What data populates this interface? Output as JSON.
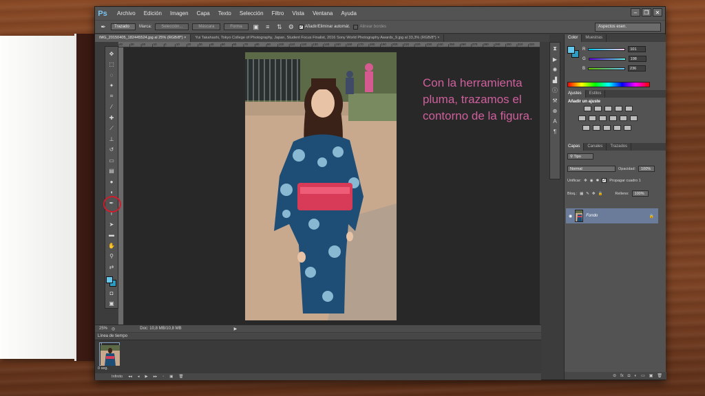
{
  "app": {
    "logo": "Ps",
    "menu": [
      "Archivo",
      "Edición",
      "Imagen",
      "Capa",
      "Texto",
      "Selección",
      "Filtro",
      "Vista",
      "Ventana",
      "Ayuda"
    ],
    "window_controls": [
      "minimize-icon",
      "restore-icon",
      "close-icon"
    ]
  },
  "options": {
    "tool_mode": "Trazado",
    "marca_label": "Marca:",
    "seleccion": "Selección...",
    "mascara": "Máscara",
    "forma": "Forma",
    "auto_add": "Añadir/Eliminar automát.",
    "align_edges": "Alinear bordes",
    "workspace": "Aspectos esen."
  },
  "tabs": [
    {
      "label": "IMG_20150405_182445524.jpg al 25% (RGB/8*)",
      "active": true
    },
    {
      "label": "Yui Takahashi, Tokyo College of Photography, Japan, Student Focus Finalist, 2016 Sony World Photography Awards_9.jpg al 33,3% (RGB/8*)",
      "active": false
    }
  ],
  "ruler_ticks": [
    "40",
    "30",
    "20",
    "10",
    "0",
    "10",
    "20",
    "30",
    "40",
    "50",
    "60",
    "70",
    "80",
    "90",
    "100",
    "110",
    "120",
    "130",
    "140",
    "150",
    "160",
    "170",
    "180",
    "190",
    "200",
    "210",
    "220",
    "230",
    "240",
    "250",
    "260",
    "270",
    "280",
    "290",
    "300",
    "310",
    "320"
  ],
  "canvas_text": "Con la herramienta pluma, trazamos el contorno de la figura.",
  "status": {
    "zoom": "25%",
    "doc": "Doc: 10,8 MB/10,8 MB"
  },
  "timeline": {
    "title": "Línea de tiempo",
    "frame_number": "1",
    "frame_delay": "0 seg.",
    "loop": "Infinito"
  },
  "color_panel": {
    "tabs": [
      "Color",
      "Muestras"
    ],
    "r_label": "R",
    "r_value": "101",
    "g_label": "G",
    "g_value": "198",
    "b_label": "B",
    "b_value": "236",
    "fg_color": "#65c6ec",
    "bg_color": "#2d9bc2"
  },
  "adjust_panel": {
    "tabs": [
      "Ajustes",
      "Estilos"
    ],
    "title": "Añadir un ajuste"
  },
  "layers_panel": {
    "tabs": [
      "Capas",
      "Canales",
      "Trazados"
    ],
    "filter": "Tipo",
    "blend_mode": "Normal",
    "opacity_label": "Opacidad:",
    "opacity_value": "100%",
    "unify_label": "Unificar:",
    "propagate": "Propagar cuadro 1",
    "lock_label": "Bloq.:",
    "fill_label": "Relleno:",
    "fill_value": "100%",
    "layer_name": "Fondo"
  },
  "accent_colors": {
    "ps_blue": "#7ac4f0",
    "highlight_red": "#d01c2b",
    "text_pink": "#cf5f9d",
    "layer_selected": "#6a7c99"
  }
}
